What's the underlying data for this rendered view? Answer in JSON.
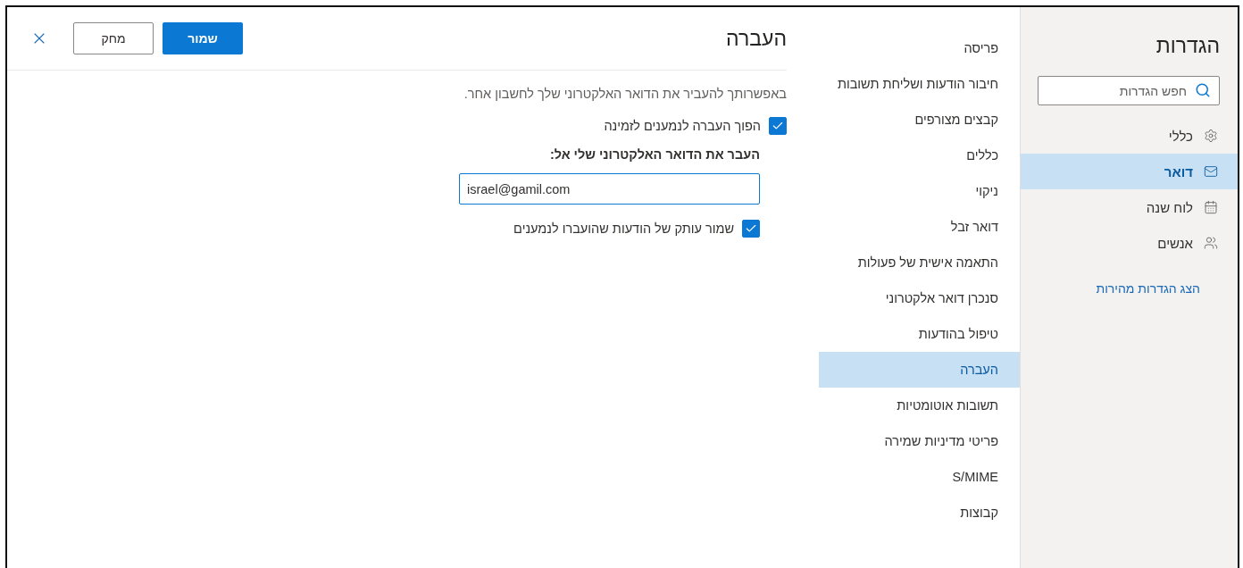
{
  "sidebar": {
    "title": "הגדרות",
    "search": {
      "placeholder": "חפש הגדרות"
    },
    "items": [
      {
        "label": "כללי",
        "selected": false
      },
      {
        "label": "דואר",
        "selected": true
      },
      {
        "label": "לוח שנה",
        "selected": false
      },
      {
        "label": "אנשים",
        "selected": false
      }
    ],
    "link": "הצג הגדרות מהירות"
  },
  "nav": {
    "items": [
      {
        "label": "פריסה",
        "selected": false
      },
      {
        "label": "חיבור הודעות ושליחת תשובות",
        "selected": false
      },
      {
        "label": "קבצים מצורפים",
        "selected": false
      },
      {
        "label": "כללים",
        "selected": false
      },
      {
        "label": "ניקוי",
        "selected": false
      },
      {
        "label": "דואר זבל",
        "selected": false
      },
      {
        "label": "התאמה אישית של פעולות",
        "selected": false
      },
      {
        "label": "סנכרן דואר אלקטרוני",
        "selected": false
      },
      {
        "label": "טיפול בהודעות",
        "selected": false
      },
      {
        "label": "העברה",
        "selected": true
      },
      {
        "label": "תשובות אוטומטיות",
        "selected": false
      },
      {
        "label": "פריטי מדיניות שמירה",
        "selected": false
      },
      {
        "label": "S/MIME",
        "selected": false
      },
      {
        "label": "קבוצות",
        "selected": false
      }
    ]
  },
  "main": {
    "title": "העברה",
    "buttons": {
      "save": "שמור",
      "discard": "מחק"
    },
    "description": "באפשרותך להעביר את הדואר האלקטרוני שלך לחשבון אחר.",
    "enable_forwarding": {
      "label": "הפוך העברה לנמענים לזמינה",
      "checked": true
    },
    "address_label": "העבר את הדואר האלקטרוני שלי אל:",
    "address_value": "israel@gamil.com",
    "keep_copy": {
      "label": "שמור עותק של הודעות שהועברו לנמענים",
      "checked": true
    }
  }
}
